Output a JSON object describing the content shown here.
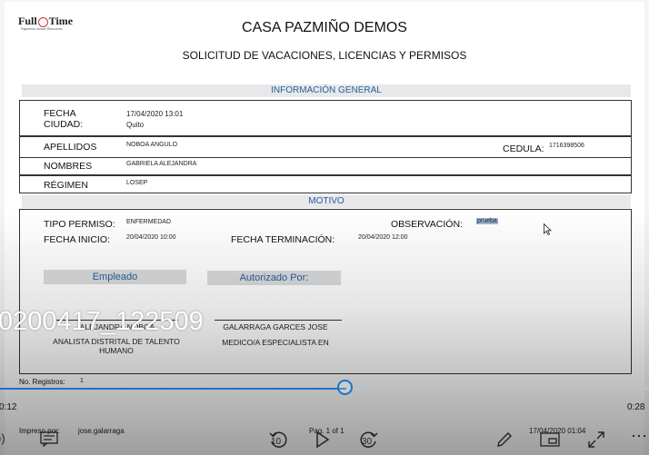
{
  "logo": {
    "text_left": "Full",
    "text_right": "Time",
    "tagline": "Paperless Human Resources"
  },
  "document": {
    "title": "CASA PAZMIÑO DEMOS",
    "subtitle": "SOLICITUD DE VACACIONES, LICENCIAS Y PERMISOS",
    "general_section": "INFORMACIÓN GENERAL",
    "fecha_label": "FECHA",
    "fecha_value": "17/04/2020 13:01",
    "ciudad_label": "CIUDAD:",
    "ciudad_value": "Quito",
    "apellidos_label": "APELLIDOS",
    "apellidos_value": "NOBOA ANGULO",
    "cedula_label": "CEDULA:",
    "cedula_value": "1716398506",
    "nombres_label": "NOMBRES",
    "nombres_value": "GABRIELA ALEJANDRA",
    "regimen_label": "RÉGIMEN",
    "regimen_value": "LOSEP",
    "motivo_section": "MOTIVO",
    "tipo_label": "TIPO PERMISO:",
    "tipo_value": "ENFERMEDAD",
    "observacion_label": "OBSERVACIÓN:",
    "observacion_value": "prueba",
    "inicio_label": "FECHA INICIO:",
    "inicio_value": "20/04/2020 10:00",
    "terminacion_label": "FECHA TERMINACIÓN:",
    "terminacion_value": "20/04/2020 12:00",
    "empleado_header": "Empleado",
    "autorizado_header": "Autorizado Por:",
    "empleado_name": "ALEJANDRA NOBOA",
    "empleado_role": "ANALISTA DISTRITAL DE TALENTO HUMANO",
    "autorizado_name": "GALARRAGA GARCES  JOSE",
    "autorizado_role": "MEDICO/A ESPECIALISTA EN",
    "registros_label": "No. Registros:",
    "registros_value": "1",
    "footer_impreso_label": "Impreso por:",
    "footer_impreso_value": "jose.galarraga",
    "footer_page": "Pag. 1 of 1",
    "footer_date": "17/04/2020 01:04"
  },
  "player": {
    "video_title": "0200417_122509",
    "elapsed": "0:12",
    "duration": "0:28",
    "progress_fraction": 0.53,
    "skip_back": "10",
    "skip_forward": "30",
    "accent_color": "#1a73c7"
  }
}
